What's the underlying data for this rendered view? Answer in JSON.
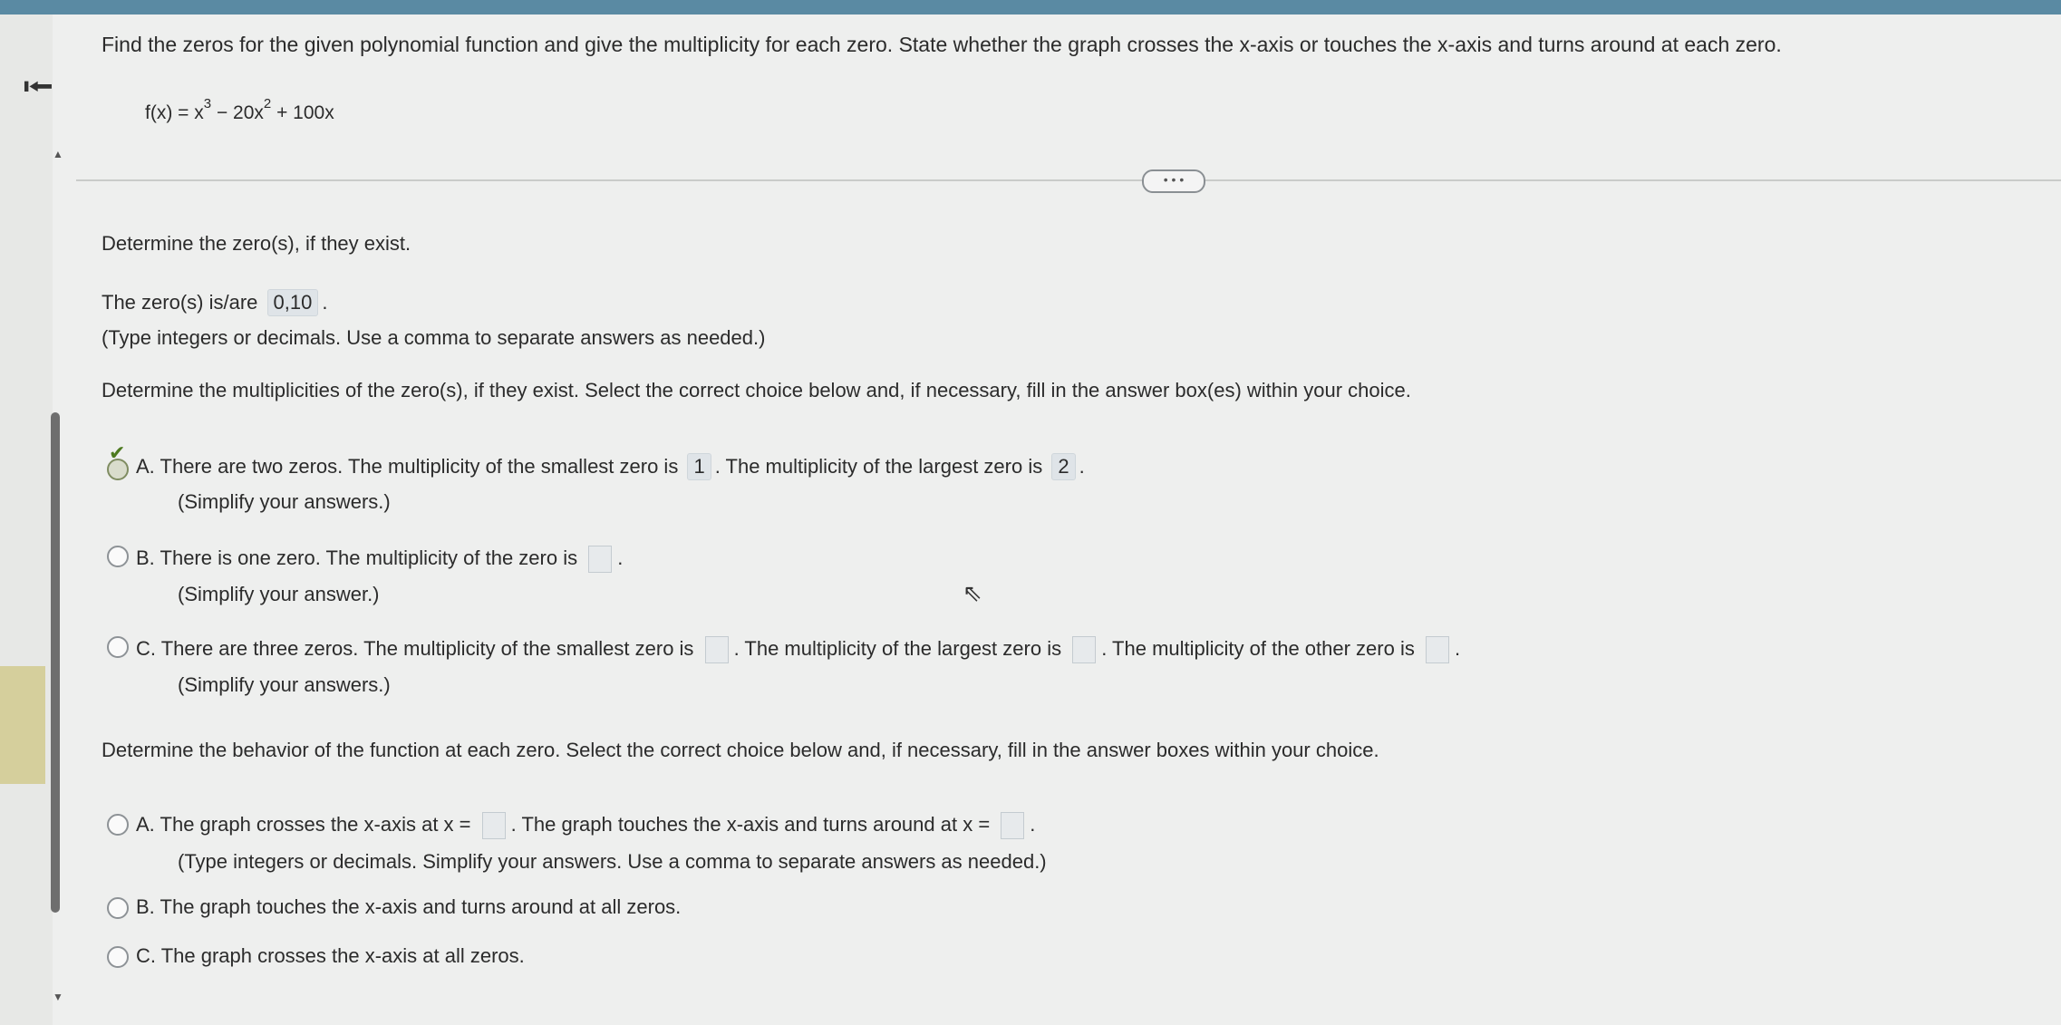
{
  "nav": {
    "back_icon": "back-arrow-icon",
    "back_glyph": "⭰"
  },
  "question": {
    "prompt": "Find the zeros for the given polynomial function and give the multiplicity for each zero. State whether the graph crosses the x-axis or touches the x-axis and turns around at each zero.",
    "function": {
      "lhs": "f(x) = x",
      "exp1": "3",
      "mid": " − 20x",
      "exp2": "2",
      "rhs": " + 100x"
    },
    "more_label": "• • •"
  },
  "part1": {
    "heading": "Determine the zero(s), if they exist.",
    "answer_prefix": "The zero(s) is/are",
    "answer_value": "0,10",
    "answer_suffix": ".",
    "hint": "(Type integers or decimals. Use a comma to separate answers as needed.)"
  },
  "part2": {
    "heading": "Determine the multiplicities of the zero(s), if they exist. Select the correct choice below and, if necessary, fill in the answer box(es) within your choice.",
    "choices": [
      {
        "letter": "A.",
        "selected": true,
        "text1": "There are two zeros. The multiplicity of the smallest zero is",
        "box1": "1",
        "text2": ". The multiplicity of the largest zero is",
        "box2": "2",
        "text3": ".",
        "note": "(Simplify your answers.)"
      },
      {
        "letter": "B.",
        "selected": false,
        "text1": "There is one zero. The multiplicity of the zero is",
        "text2": ".",
        "note": "(Simplify your answer.)"
      },
      {
        "letter": "C.",
        "selected": false,
        "text1": "There are three zeros. The multiplicity of the smallest zero is",
        "text2": ". The multiplicity of the largest zero is",
        "text3": ". The multiplicity of the other zero is",
        "text4": ".",
        "note": "(Simplify your answers.)"
      }
    ]
  },
  "part3": {
    "heading": "Determine the behavior of the function at each zero. Select the correct choice below and, if necessary, fill in the answer boxes within your choice.",
    "choices": [
      {
        "letter": "A.",
        "text1": "The graph crosses the x-axis at x =",
        "text2": ". The graph touches the x-axis and turns around at x =",
        "text3": ".",
        "note": "(Type integers or decimals. Simplify your answers. Use a comma to separate answers as needed.)"
      },
      {
        "letter": "B.",
        "text1": "The graph touches the x-axis and turns around at all zeros."
      },
      {
        "letter": "C.",
        "text1": "The graph crosses the x-axis at all zeros."
      }
    ]
  }
}
